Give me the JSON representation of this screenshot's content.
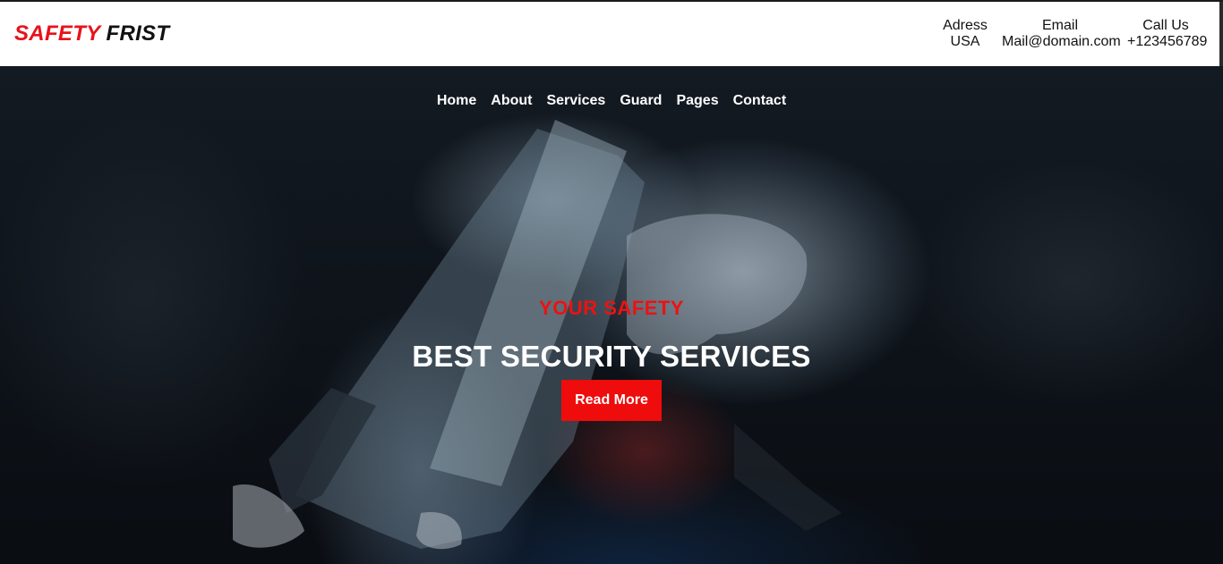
{
  "brand": {
    "word1": "SAFETY",
    "word2": "FRIST",
    "accent_color": "#e8121a"
  },
  "contacts": [
    {
      "label": "Adress",
      "value": "USA"
    },
    {
      "label": "Email",
      "value": "Mail@domain.com"
    },
    {
      "label": "Call Us",
      "value": "+123456789"
    }
  ],
  "nav": [
    "Home",
    "About",
    "Services",
    "Guard",
    "Pages",
    "Contact"
  ],
  "hero": {
    "subtitle": "YOUR SAFETY",
    "title": "BEST SECURITY SERVICES",
    "button_label": "Read More",
    "button_color": "#ee0c0c",
    "background_image": "dark smoky photo of a hand holding a submachine gun"
  }
}
